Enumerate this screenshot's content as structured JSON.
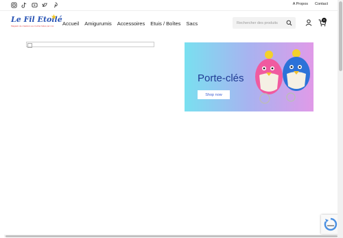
{
  "header": {
    "social_icons": [
      "instagram-icon",
      "tiktok-icon",
      "youtube-icon",
      "twitter-icon",
      "pinterest-icon"
    ],
    "top_links": [
      "A Propos",
      "Contact"
    ]
  },
  "logo": {
    "text": "Le Fil Etoilé",
    "tagline": "Magasin de créations au crochet faites par moi"
  },
  "nav": {
    "items": [
      "Accueil",
      "Amigurumis",
      "Accessoires",
      "Etuis / Boîtes",
      "Sacs"
    ]
  },
  "search": {
    "placeholder": "Rechercher des produits"
  },
  "cart": {
    "count": "0"
  },
  "promo": {
    "title": "Porte-clés",
    "button": "Shop now"
  },
  "colors": {
    "brand_blue": "#2a55b5",
    "promo_title": "#1f3a93"
  }
}
